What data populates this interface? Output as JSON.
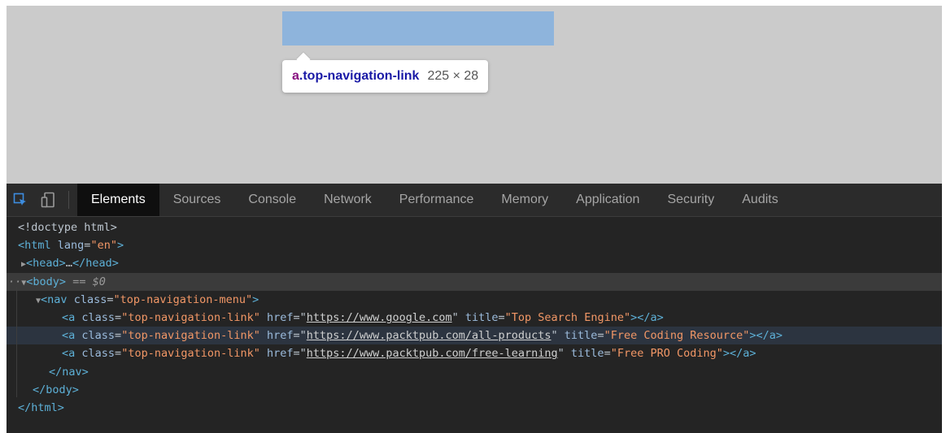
{
  "tooltip": {
    "tag": "a",
    "class": ".top-navigation-link",
    "size": "225 × 28"
  },
  "devtools": {
    "tabs": [
      "Elements",
      "Sources",
      "Console",
      "Network",
      "Performance",
      "Memory",
      "Application",
      "Security",
      "Audits"
    ],
    "active_tab": "Elements"
  },
  "dom": {
    "doctype": "<!doctype html>",
    "html_open": {
      "tag": "<html",
      "attr": "lang",
      "value": "\"en\"",
      "close": ">"
    },
    "head": {
      "open": "<head>",
      "ellipsis": "…",
      "close": "</head>"
    },
    "body": {
      "open": "<body>",
      "console_ref": "== $0"
    },
    "nav": {
      "tag": "<nav",
      "attr": "class",
      "value": "\"top-navigation-menu\"",
      "close": ">"
    },
    "links": [
      {
        "class": "\"top-navigation-link\"",
        "href": "https://www.google.com",
        "title": "\"Top Search Engine\""
      },
      {
        "class": "\"top-navigation-link\"",
        "href": "https://www.packtpub.com/all-products",
        "title": "\"Free Coding Resource\""
      },
      {
        "class": "\"top-navigation-link\"",
        "href": "https://www.packtpub.com/free-learning",
        "title": "\"Free PRO Coding\""
      }
    ],
    "nav_close": "</nav>",
    "body_close": "</body>",
    "html_close": "</html>"
  },
  "colors": {
    "highlight": "#8eb4dc",
    "devtools_bg": "#242424",
    "tag": "#5db0d7",
    "attr_value": "#f29766"
  },
  "icons": {
    "inspect": "inspect-element-icon",
    "device": "device-toolbar-icon"
  }
}
